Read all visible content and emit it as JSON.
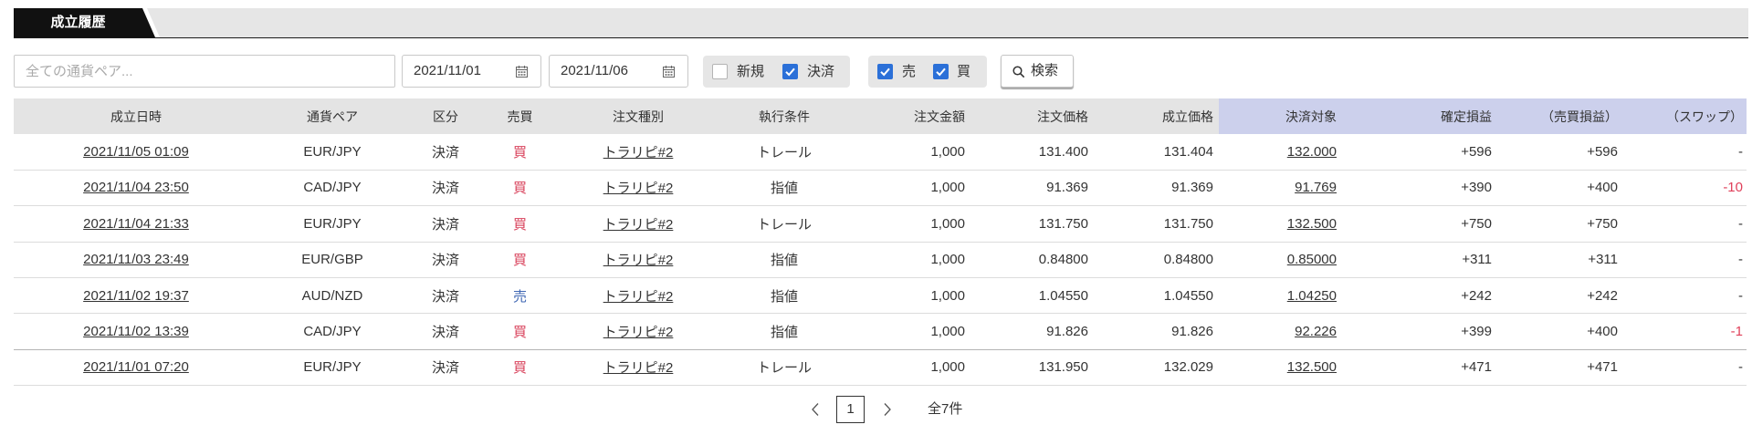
{
  "tab": {
    "label": "成立履歴"
  },
  "filters": {
    "pair": {
      "placeholder": "全ての通貨ペア..."
    },
    "date_from": {
      "value": "2021/11/01",
      "icon": "calendar-icon"
    },
    "date_to": {
      "value": "2021/11/06",
      "icon": "calendar-icon"
    },
    "kind_group": [
      {
        "label": "新規",
        "checked": false
      },
      {
        "label": "決済",
        "checked": true
      }
    ],
    "side_group": [
      {
        "label": "売",
        "checked": true
      },
      {
        "label": "買",
        "checked": true
      }
    ],
    "search_button": {
      "label": "検索",
      "icon": "search-icon"
    }
  },
  "table": {
    "columns": [
      "成立日時",
      "通貨ペア",
      "区分",
      "売買",
      "注文種別",
      "執行条件",
      "注文金額",
      "注文価格",
      "成立価格",
      "決済対象",
      "確定損益",
      "（売買損益）",
      "（スワップ）"
    ],
    "rows": [
      {
        "datetime": "2021/11/05 01:09",
        "pair": "EUR/JPY",
        "category": "決済",
        "side": "買",
        "order_type": "トラリピ#2",
        "condition": "トレール",
        "amount": "1,000",
        "order_price": "131.400",
        "fill_price": "131.404",
        "settle_target": "132.000",
        "realized_pl": "+596",
        "trade_pl": "+596",
        "swap": "-"
      },
      {
        "datetime": "2021/11/04 23:50",
        "pair": "CAD/JPY",
        "category": "決済",
        "side": "買",
        "order_type": "トラリピ#2",
        "condition": "指値",
        "amount": "1,000",
        "order_price": "91.369",
        "fill_price": "91.369",
        "settle_target": "91.769",
        "realized_pl": "+390",
        "trade_pl": "+400",
        "swap": "-10"
      },
      {
        "datetime": "2021/11/04 21:33",
        "pair": "EUR/JPY",
        "category": "決済",
        "side": "買",
        "order_type": "トラリピ#2",
        "condition": "トレール",
        "amount": "1,000",
        "order_price": "131.750",
        "fill_price": "131.750",
        "settle_target": "132.500",
        "realized_pl": "+750",
        "trade_pl": "+750",
        "swap": "-"
      },
      {
        "datetime": "2021/11/03 23:49",
        "pair": "EUR/GBP",
        "category": "決済",
        "side": "買",
        "order_type": "トラリピ#2",
        "condition": "指値",
        "amount": "1,000",
        "order_price": "0.84800",
        "fill_price": "0.84800",
        "settle_target": "0.85000",
        "realized_pl": "+311",
        "trade_pl": "+311",
        "swap": "-"
      },
      {
        "datetime": "2021/11/02 19:37",
        "pair": "AUD/NZD",
        "category": "決済",
        "side": "売",
        "order_type": "トラリピ#2",
        "condition": "指値",
        "amount": "1,000",
        "order_price": "1.04550",
        "fill_price": "1.04550",
        "settle_target": "1.04250",
        "realized_pl": "+242",
        "trade_pl": "+242",
        "swap": "-"
      },
      {
        "datetime": "2021/11/02 13:39",
        "pair": "CAD/JPY",
        "category": "決済",
        "side": "買",
        "order_type": "トラリピ#2",
        "condition": "指値",
        "amount": "1,000",
        "order_price": "91.826",
        "fill_price": "91.826",
        "settle_target": "92.226",
        "realized_pl": "+399",
        "trade_pl": "+400",
        "swap": "-1"
      },
      {
        "datetime": "2021/11/01 07:20",
        "pair": "EUR/JPY",
        "category": "決済",
        "side": "買",
        "order_type": "トラリピ#2",
        "condition": "トレール",
        "amount": "1,000",
        "order_price": "131.950",
        "fill_price": "132.029",
        "settle_target": "132.500",
        "realized_pl": "+471",
        "trade_pl": "+471",
        "swap": "-"
      }
    ]
  },
  "pagination": {
    "prev_icon": "chevron-left-icon",
    "current_page": "1",
    "next_icon": "chevron-right-icon",
    "total": "全7件"
  },
  "colors": {
    "tab_bg": "#111111",
    "tab_bar_bg": "#e6e6e6",
    "header_bg": "#e4e4e4",
    "header_settle_bg": "#ccd0ec",
    "buy": "#d8405a",
    "sell": "#3f67b3",
    "negative": "#e0405a",
    "checkbox_checked": "#2b70d8"
  }
}
